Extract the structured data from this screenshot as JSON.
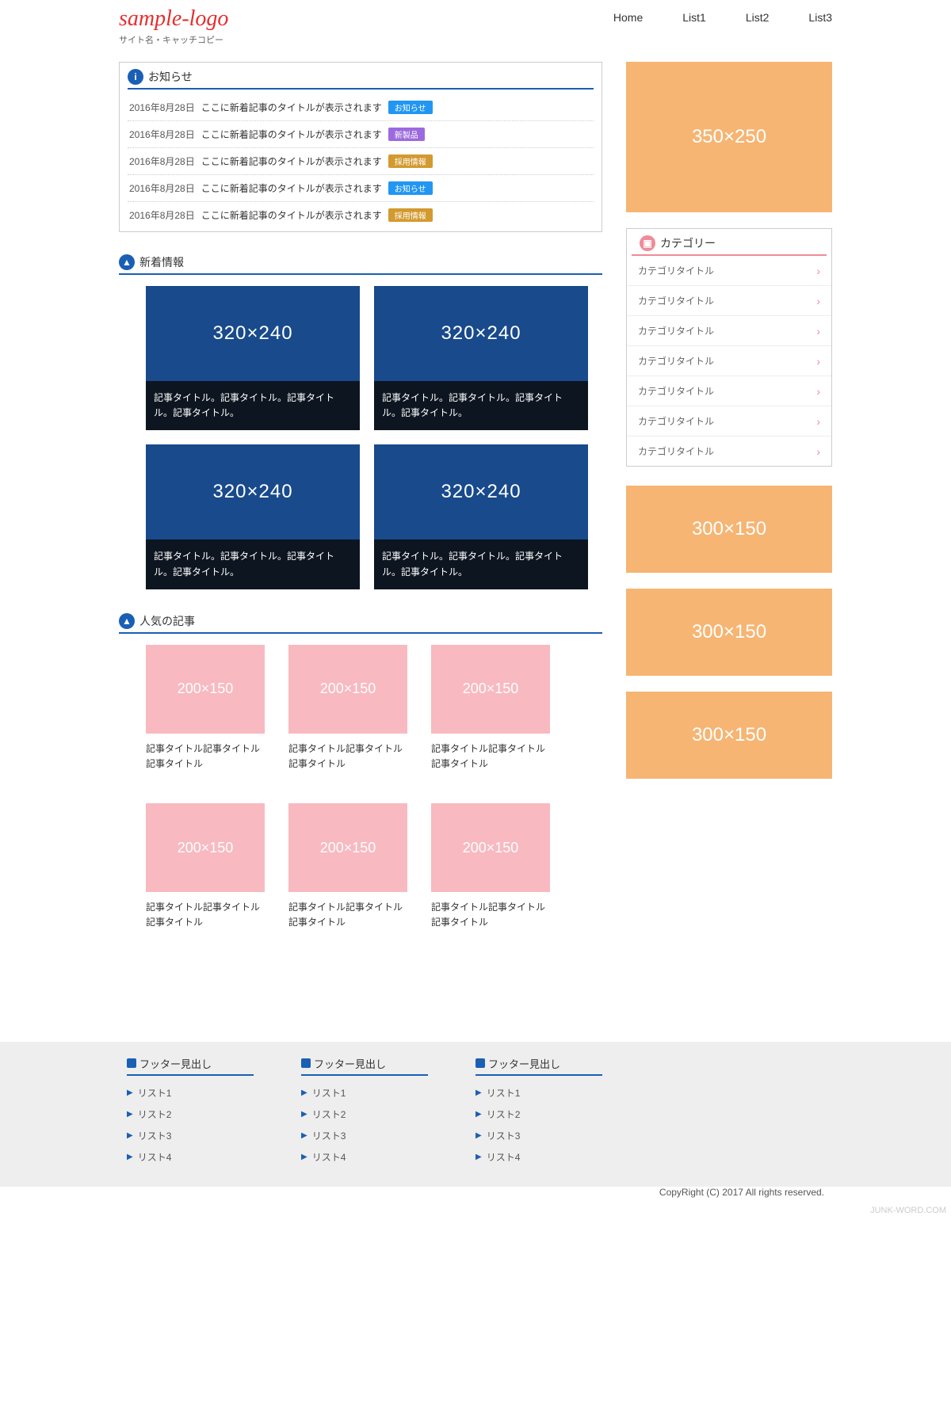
{
  "header": {
    "logo": "sample-logo",
    "tagline": "サイト名・キャッチコピー",
    "nav": [
      "Home",
      "List1",
      "List2",
      "List3"
    ]
  },
  "notice": {
    "title": "お知らせ",
    "items": [
      {
        "date": "2016年8月28日",
        "title": "ここに新着記事のタイトルが表示されます",
        "badge": "お知らせ",
        "color": "blue"
      },
      {
        "date": "2016年8月28日",
        "title": "ここに新着記事のタイトルが表示されます",
        "badge": "新製品",
        "color": "purple"
      },
      {
        "date": "2016年8月28日",
        "title": "ここに新着記事のタイトルが表示されます",
        "badge": "採用情報",
        "color": "orange"
      },
      {
        "date": "2016年8月28日",
        "title": "ここに新着記事のタイトルが表示されます",
        "badge": "お知らせ",
        "color": "blue"
      },
      {
        "date": "2016年8月28日",
        "title": "ここに新着記事のタイトルが表示されます",
        "badge": "採用情報",
        "color": "orange"
      }
    ]
  },
  "latest": {
    "title": "新着情報",
    "thumb_label": "320×240",
    "items": [
      {
        "title": "記事タイトル。記事タイトル。記事タイトル。記事タイトル。"
      },
      {
        "title": "記事タイトル。記事タイトル。記事タイトル。記事タイトル。"
      },
      {
        "title": "記事タイトル。記事タイトル。記事タイトル。記事タイトル。"
      },
      {
        "title": "記事タイトル。記事タイトル。記事タイトル。記事タイトル。"
      }
    ]
  },
  "popular": {
    "title": "人気の記事",
    "thumb_label": "200×150",
    "items": [
      {
        "title": "記事タイトル記事タイトル記事タイトル"
      },
      {
        "title": "記事タイトル記事タイトル記事タイトル"
      },
      {
        "title": "記事タイトル記事タイトル記事タイトル"
      },
      {
        "title": "記事タイトル記事タイトル記事タイトル"
      },
      {
        "title": "記事タイトル記事タイトル記事タイトル"
      },
      {
        "title": "記事タイトル記事タイトル記事タイトル"
      }
    ]
  },
  "side": {
    "banner_lg": "350×250",
    "cat_title": "カテゴリー",
    "cats": [
      "カテゴリタイトル",
      "カテゴリタイトル",
      "カテゴリタイトル",
      "カテゴリタイトル",
      "カテゴリタイトル",
      "カテゴリタイトル",
      "カテゴリタイトル"
    ],
    "banner_sm": "300×150"
  },
  "footer": {
    "head": "フッター見出し",
    "items": [
      "リスト1",
      "リスト2",
      "リスト3",
      "リスト4"
    ],
    "copy": "CopyRight (C) 2017 All rights reserved.",
    "watermark": "JUNK-WORD.COM"
  }
}
